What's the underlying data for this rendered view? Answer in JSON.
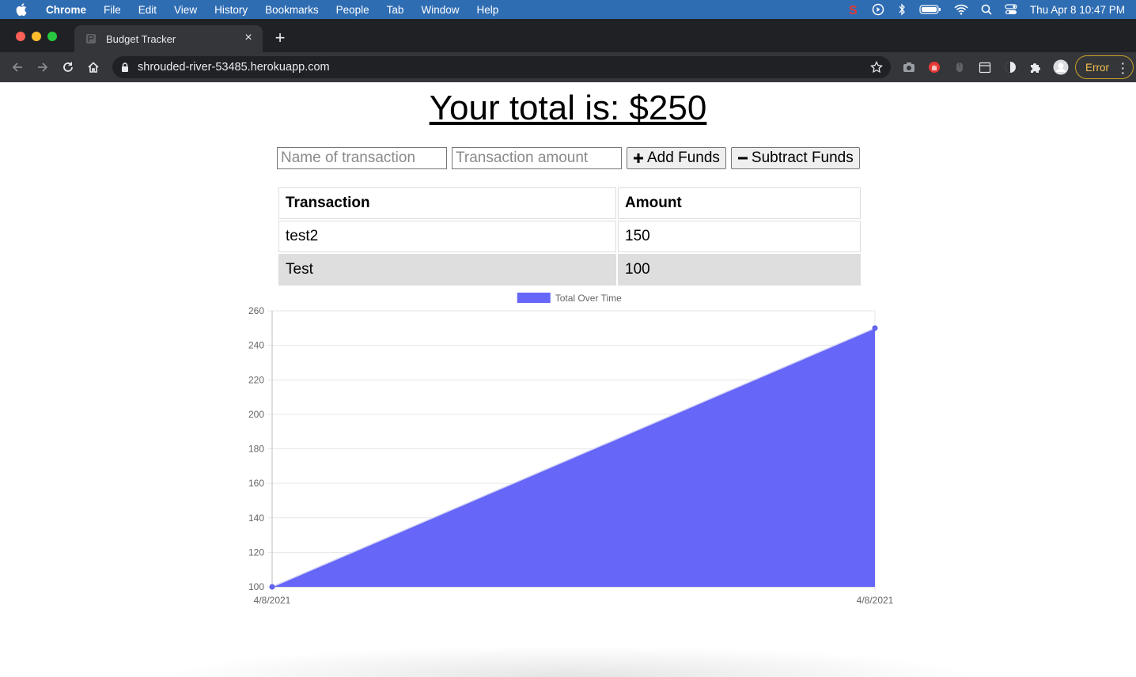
{
  "menubar": {
    "app": "Chrome",
    "items": [
      "File",
      "Edit",
      "View",
      "History",
      "Bookmarks",
      "People",
      "Tab",
      "Window",
      "Help"
    ],
    "datetime": "Thu Apr 8  10:47 PM"
  },
  "browser": {
    "tab_title": "Budget Tracker",
    "url": "shrouded-river-53485.herokuapp.com",
    "error_label": "Error"
  },
  "page": {
    "total_text": "Your total is: $250",
    "name_placeholder": "Name of transaction",
    "amount_placeholder": "Transaction amount",
    "add_label": "Add Funds",
    "subtract_label": "Subtract Funds",
    "table": {
      "headers": [
        "Transaction",
        "Amount"
      ],
      "rows": [
        {
          "name": "test2",
          "amount": "150"
        },
        {
          "name": "Test",
          "amount": "100"
        }
      ]
    }
  },
  "chart_data": {
    "type": "area",
    "x": [
      "4/8/2021",
      "4/8/2021"
    ],
    "series": [
      {
        "name": "Total Over Time",
        "values": [
          100,
          250
        ],
        "color": "#6666f8"
      }
    ],
    "ylim": [
      100,
      260
    ],
    "yticks": [
      100,
      120,
      140,
      160,
      180,
      200,
      220,
      240,
      260
    ],
    "legend": "top",
    "grid": true
  }
}
